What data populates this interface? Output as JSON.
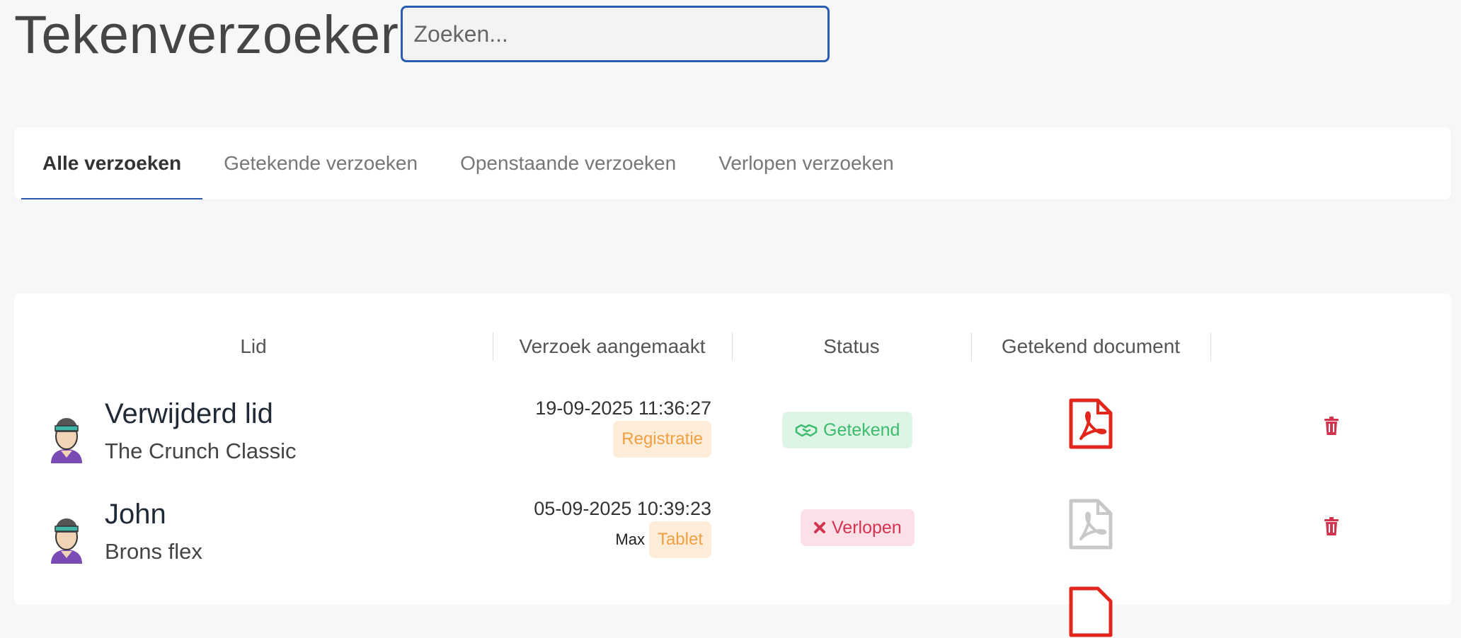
{
  "header": {
    "title": "Tekenverzoeker",
    "search_placeholder": "Zoeken..."
  },
  "tabs": [
    {
      "label": "Alle verzoeken",
      "active": true
    },
    {
      "label": "Getekende verzoeken",
      "active": false
    },
    {
      "label": "Openstaande verzoeken",
      "active": false
    },
    {
      "label": "Verlopen verzoeken",
      "active": false
    }
  ],
  "table": {
    "columns": [
      "Lid",
      "Verzoek aangemaakt",
      "Status",
      "Getekend document",
      ""
    ],
    "rows": [
      {
        "member": "Verwijderd lid",
        "plan": "The Crunch Classic",
        "created": "19-09-2025 11:36:27",
        "created_by": "",
        "source": "Registratie",
        "status": "Getekend",
        "status_icon": "handshake-icon",
        "document": "pdf-available"
      },
      {
        "member": "John",
        "plan": "Brons flex",
        "created": "05-09-2025 10:39:23",
        "created_by": "Max",
        "source": "Tablet",
        "status": "Verlopen",
        "status_icon": "x-icon",
        "document": "pdf-unavailable"
      }
    ]
  },
  "colors": {
    "accent": "#2a5db0",
    "signed_bg": "#def5e6",
    "signed_text": "#3dbb6e",
    "expired_bg": "#fbe0e7",
    "expired_text": "#d2334f",
    "pdf_red": "#e2261c",
    "pdf_gray": "#c8c8c8",
    "trash": "#d2334f"
  }
}
